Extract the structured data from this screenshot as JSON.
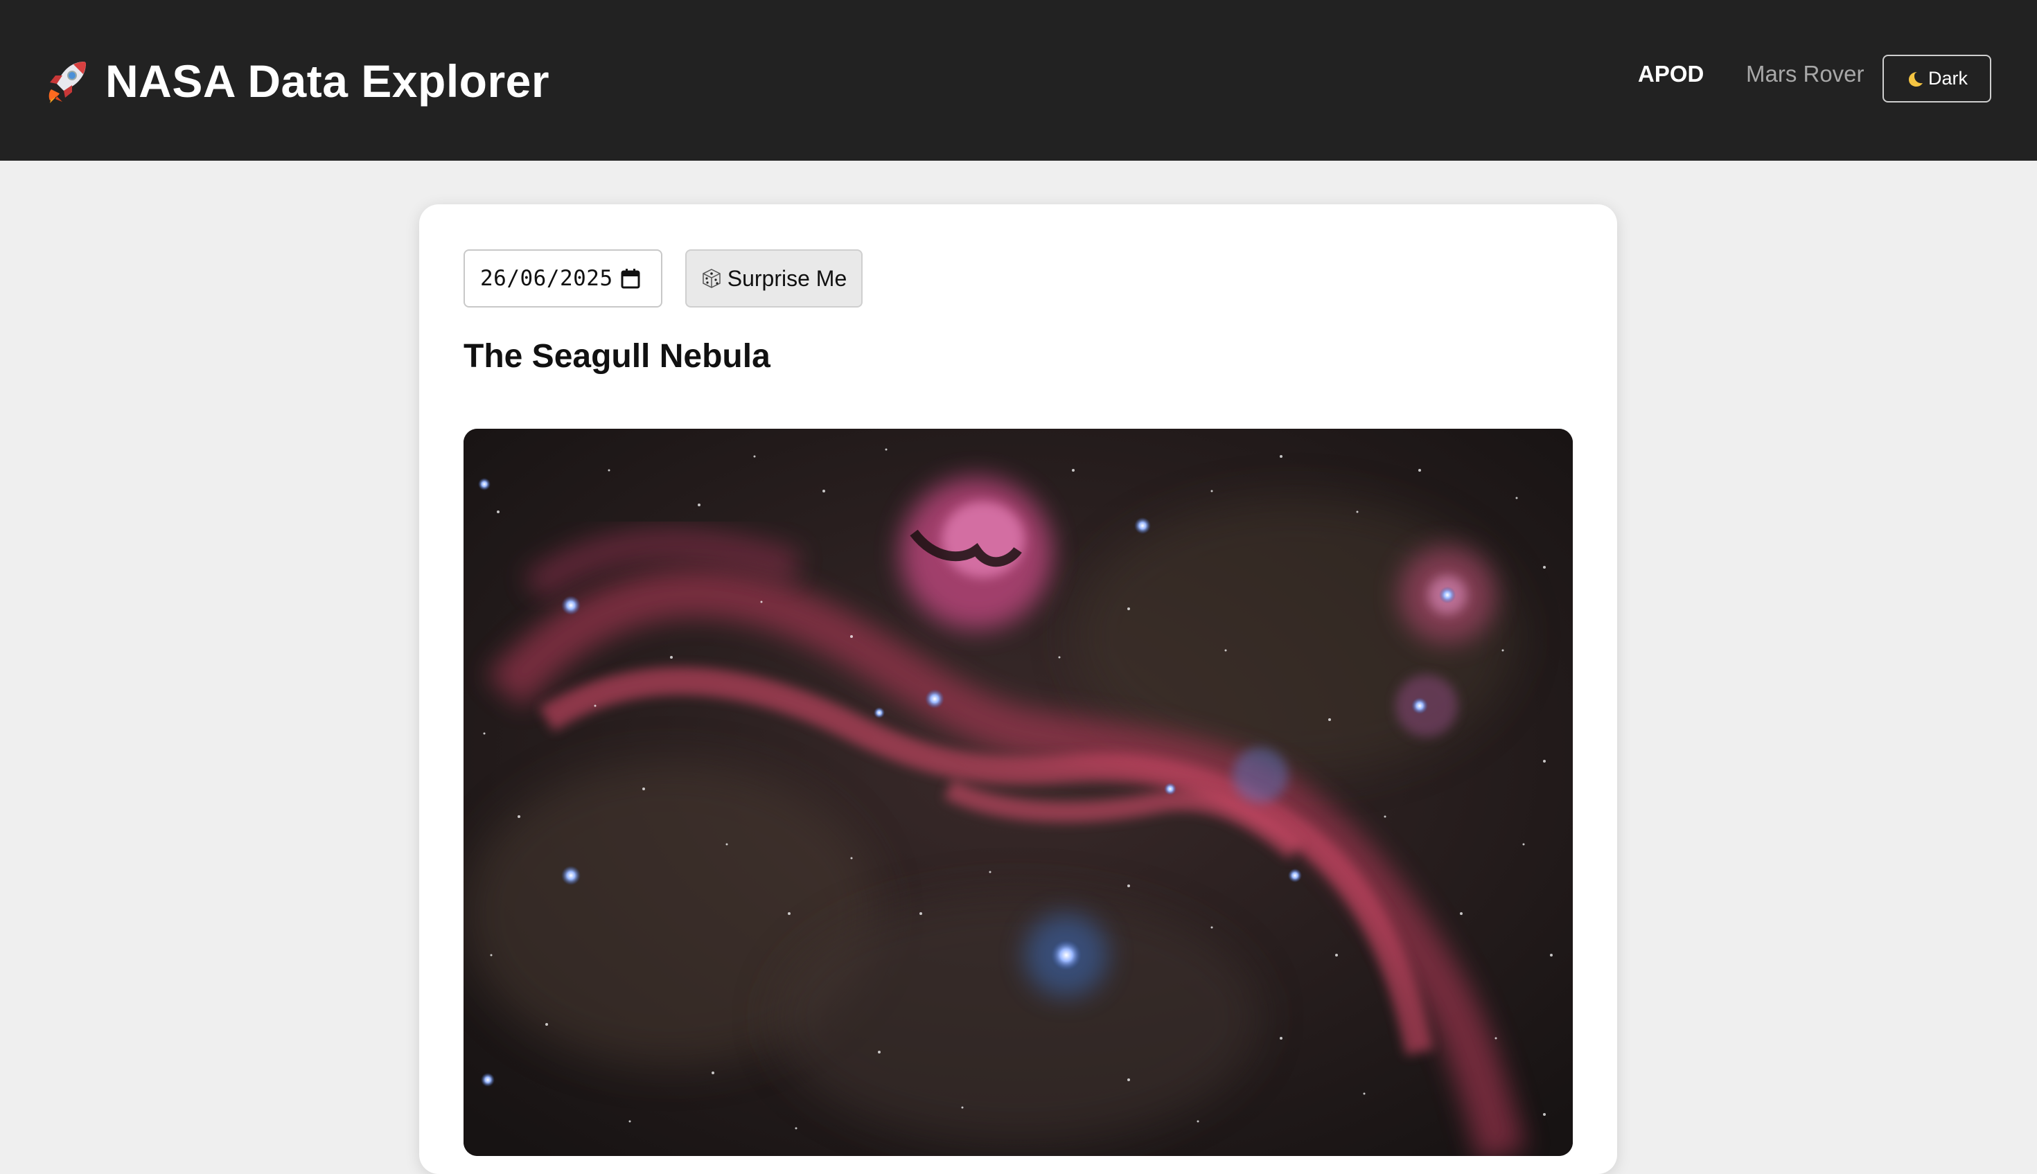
{
  "app": {
    "title": "NASA Data Explorer",
    "brand_icon": "rocket-icon"
  },
  "nav": {
    "items": [
      {
        "label": "APOD",
        "active": true
      },
      {
        "label": "Mars Rover",
        "active": false
      }
    ],
    "theme_toggle": {
      "label": "Dark",
      "icon": "moon-icon"
    }
  },
  "apod": {
    "date_value": "26/06/2025",
    "surprise_label": "Surprise Me",
    "surprise_icon": "dice-icon",
    "title": "The Seagull Nebula"
  },
  "colors": {
    "navbar_bg": "#222222",
    "page_bg": "#efefef",
    "card_bg": "#ffffff",
    "nav_active": "#ffffff",
    "nav_inactive": "#a8a8a8"
  }
}
